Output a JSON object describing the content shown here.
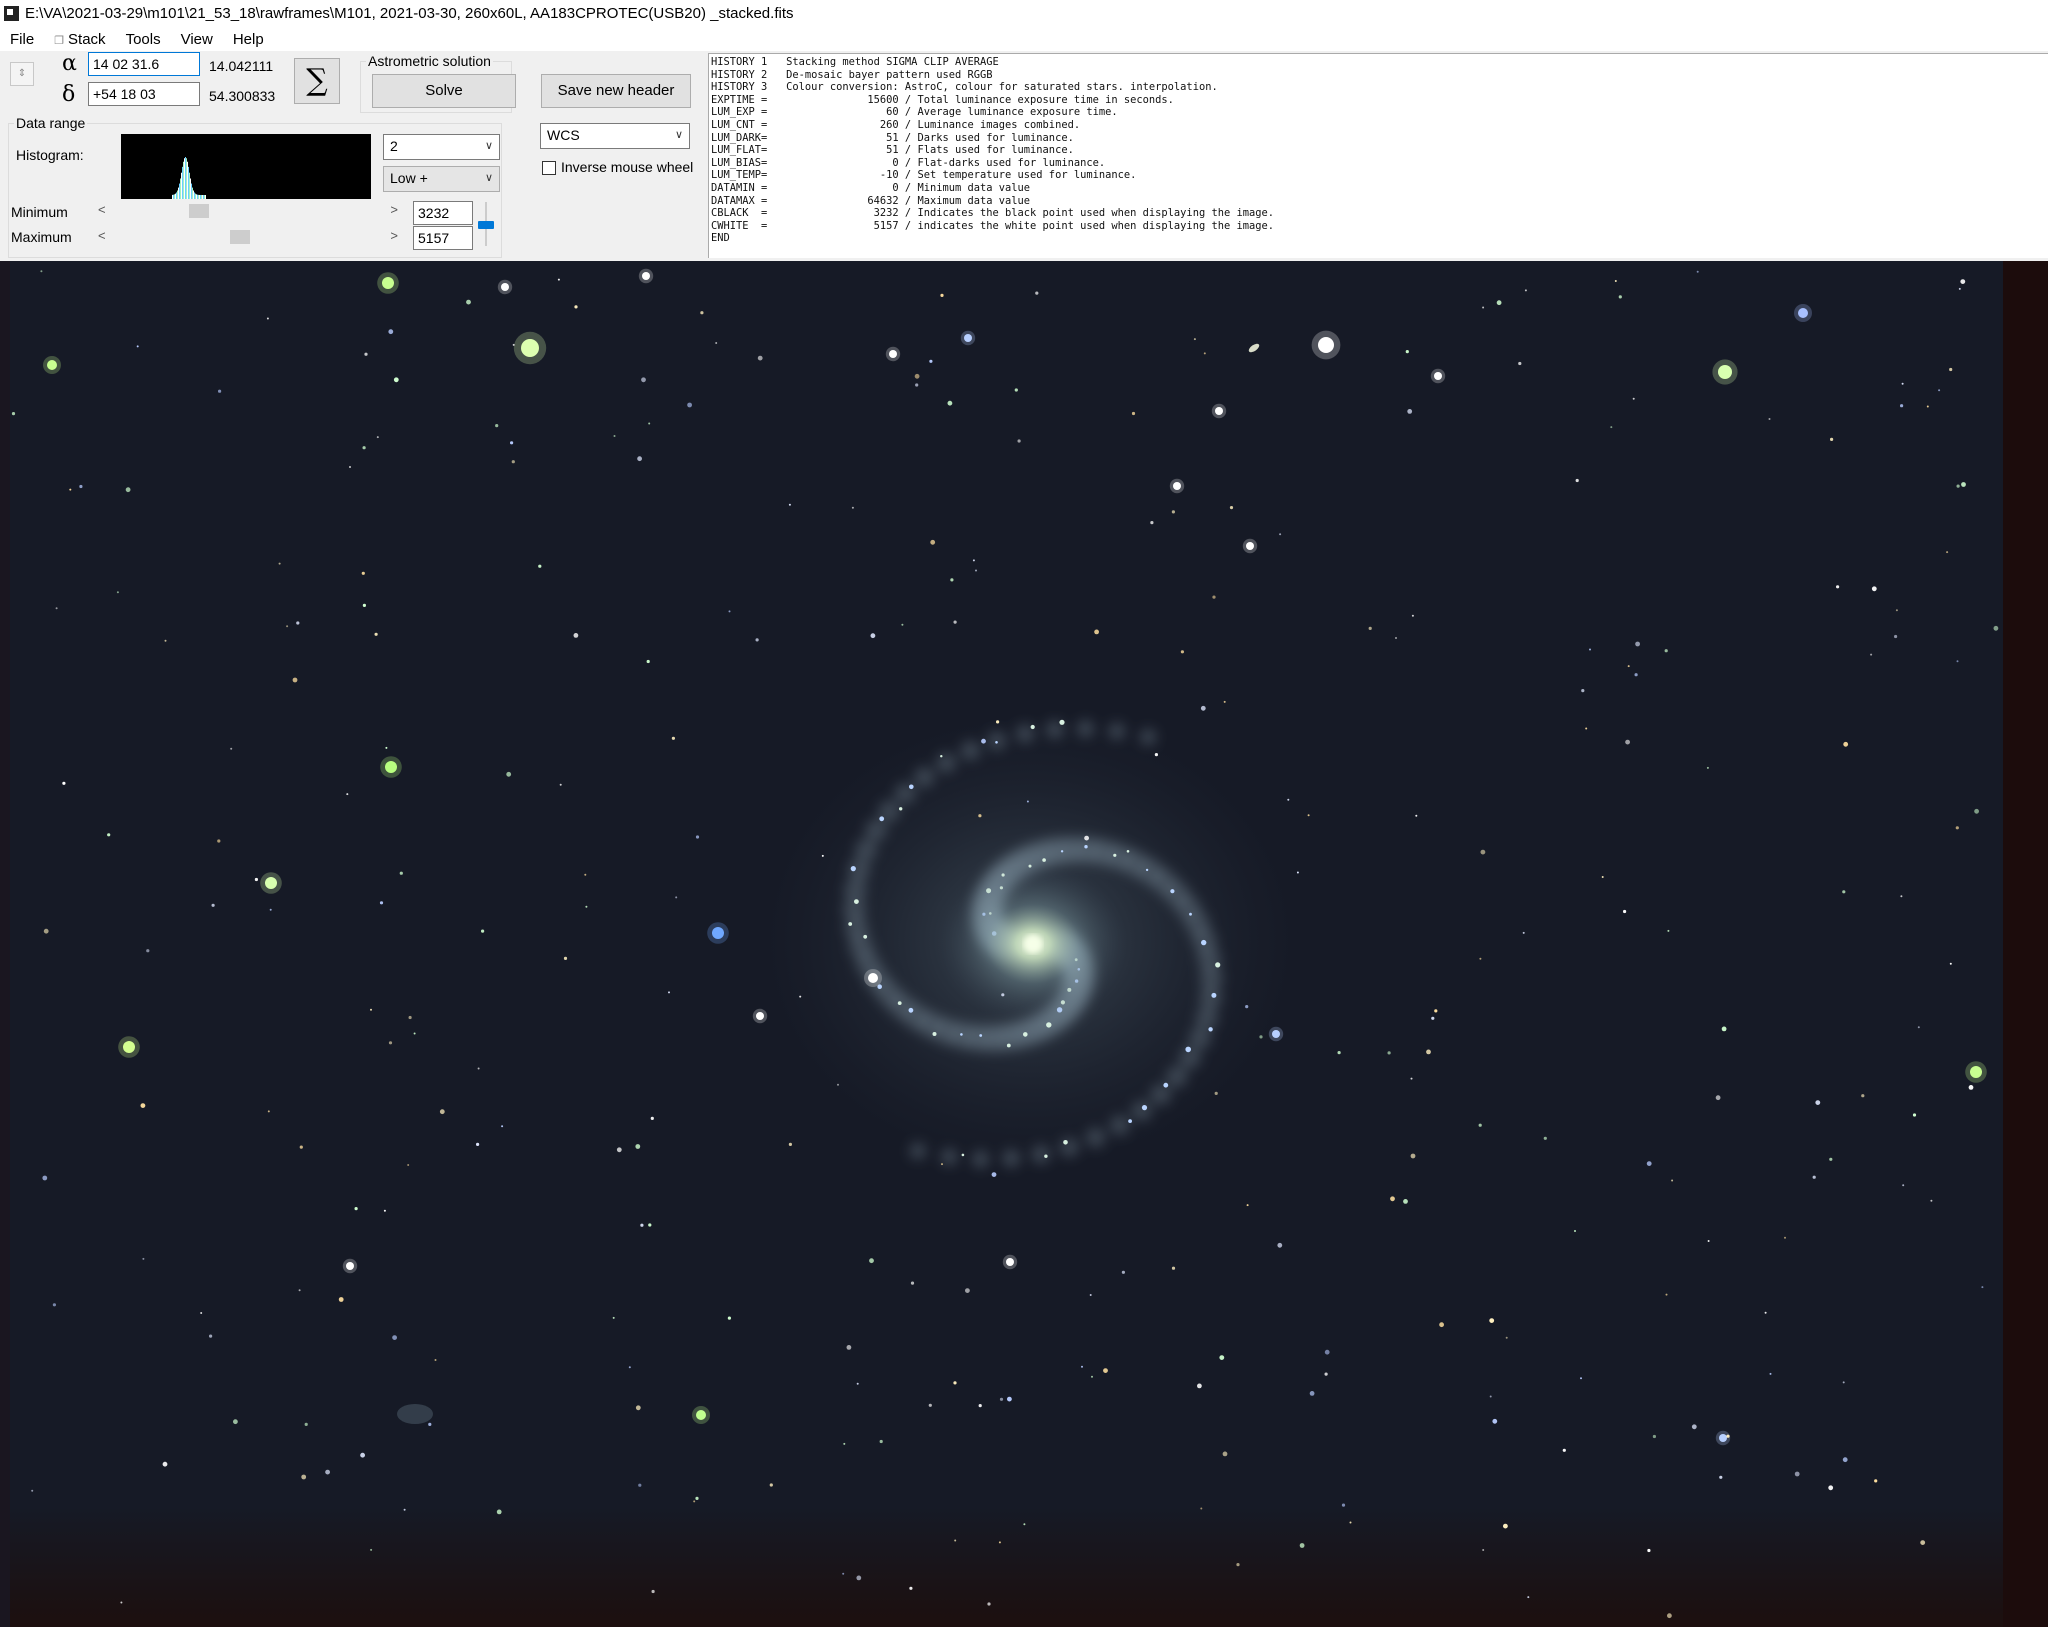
{
  "window": {
    "title": "E:\\VA\\2021-03-29\\m101\\21_53_18\\rawframes\\M101, 2021-03-30, 260x60L, AA183CPROTEC(USB20)  _stacked.fits"
  },
  "menu": {
    "items": [
      "File",
      "Stack",
      "Tools",
      "View",
      "Help"
    ]
  },
  "coords": {
    "alpha_symbol": "α",
    "alpha_value": "14 02  31.6",
    "alpha_decimal": "14.042111",
    "delta_symbol": "δ",
    "delta_value": "+54 18  03",
    "delta_decimal": "54.300833"
  },
  "sigma_label": "∑",
  "astrometric": {
    "label": "Astrometric solution",
    "solve_label": "Solve"
  },
  "save_header_label": "Save new header",
  "data_range": {
    "label": "Data range",
    "histogram_label": "Histogram:",
    "bin_select": "2",
    "stretch_select": "Low +",
    "minimum_label": "Minimum",
    "maximum_label": "Maximum",
    "minimum_value": "3232",
    "maximum_value": "5157",
    "minimum_fraction": 0.31,
    "maximum_fraction": 0.47
  },
  "wcs_select": "WCS",
  "inverse_mouse_wheel": {
    "label": "Inverse mouse wheel",
    "checked": false
  },
  "fits_header": [
    "HISTORY 1   Stacking method SIGMA CLIP AVERAGE",
    "HISTORY 2   De-mosaic bayer pattern used RGGB",
    "HISTORY 3   Colour conversion: AstroC, colour for saturated stars. interpolation.",
    "EXPTIME =                15600 / Total luminance exposure time in seconds.",
    "LUM_EXP =                   60 / Average luminance exposure time.",
    "LUM_CNT =                  260 / Luminance images combined.",
    "LUM_DARK=                   51 / Darks used for luminance.",
    "LUM_FLAT=                   51 / Flats used for luminance.",
    "LUM_BIAS=                    0 / Flat-darks used for luminance.",
    "LUM_TEMP=                  -10 / Set temperature used for luminance.",
    "DATAMIN =                    0 / Minimum data value",
    "DATAMAX =                64632 / Maximum data value",
    "CBLACK  =                 3232 / Indicates the black point used when displaying the image.",
    "CWHITE  =                 5157 / indicates the white point used when displaying the image.",
    "END"
  ],
  "colors": {
    "sky": "#161a26",
    "galaxy_core": "#e8ffd8",
    "galaxy_arms": "#8fa6b4",
    "focus_blue": "#0078d7"
  }
}
